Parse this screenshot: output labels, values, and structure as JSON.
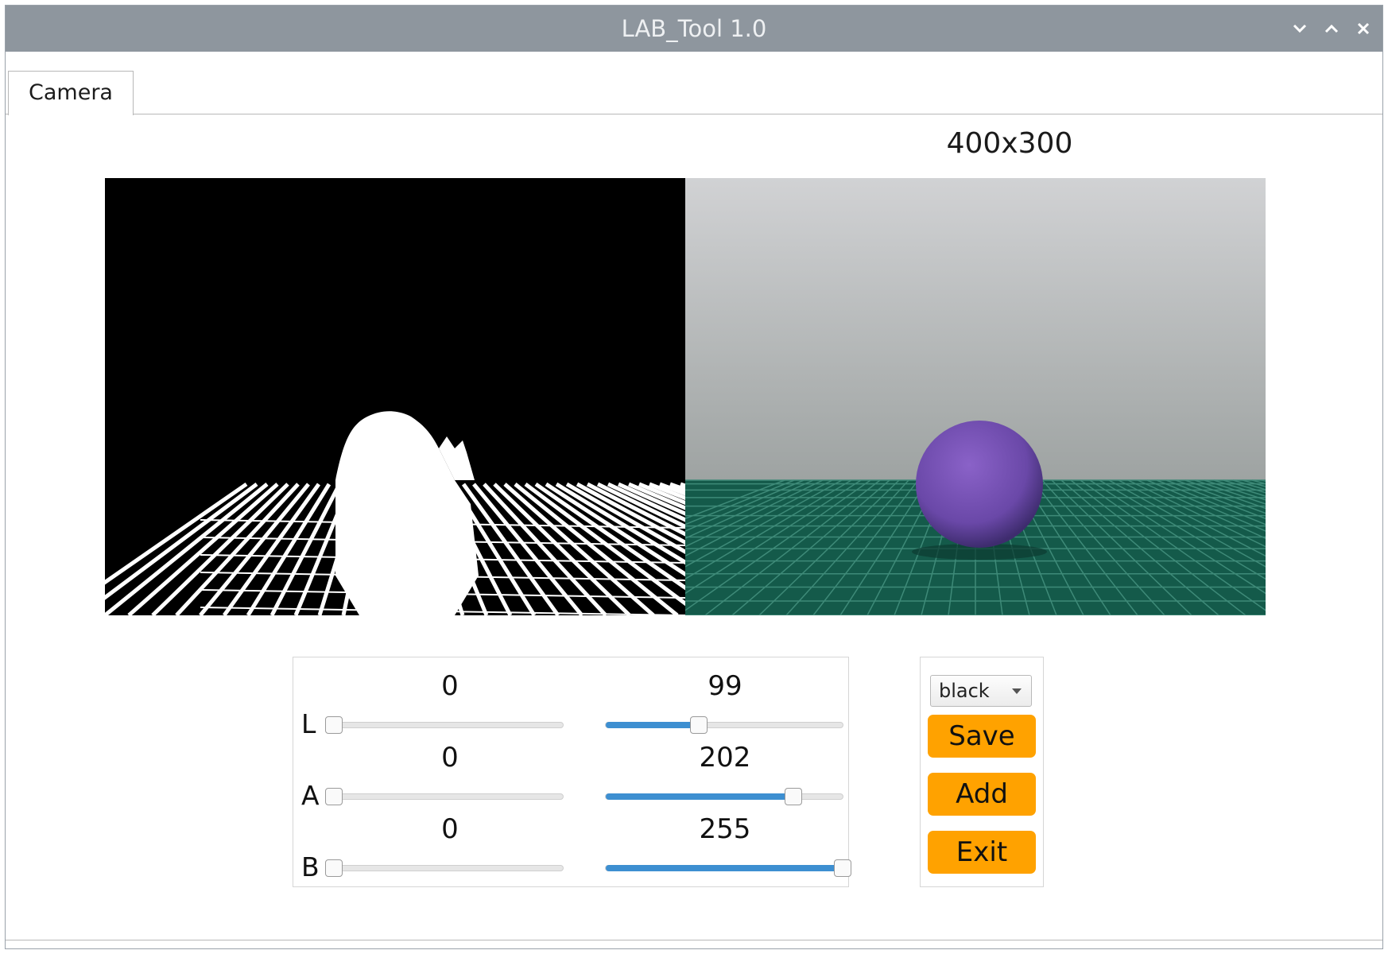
{
  "window": {
    "title": "LAB_Tool 1.0",
    "controls": [
      "chevron-down-icon",
      "chevron-up-icon",
      "close-icon"
    ]
  },
  "tabs": [
    {
      "label": "Camera",
      "active": true
    }
  ],
  "camera": {
    "resolution": "400x300"
  },
  "sliders": {
    "range_max": 255,
    "channels": [
      {
        "name": "L",
        "min_value": "0",
        "max_value": "99",
        "min": 0,
        "max": 99
      },
      {
        "name": "A",
        "min_value": "0",
        "max_value": "202",
        "min": 0,
        "max": 202
      },
      {
        "name": "B",
        "min_value": "0",
        "max_value": "255",
        "min": 0,
        "max": 255
      }
    ],
    "accent": "#3d8fd1"
  },
  "actions": {
    "color_select": {
      "selected": "black"
    },
    "save_label": "Save",
    "add_label": "Add",
    "exit_label": "Exit",
    "button_color": "#ffa200"
  }
}
